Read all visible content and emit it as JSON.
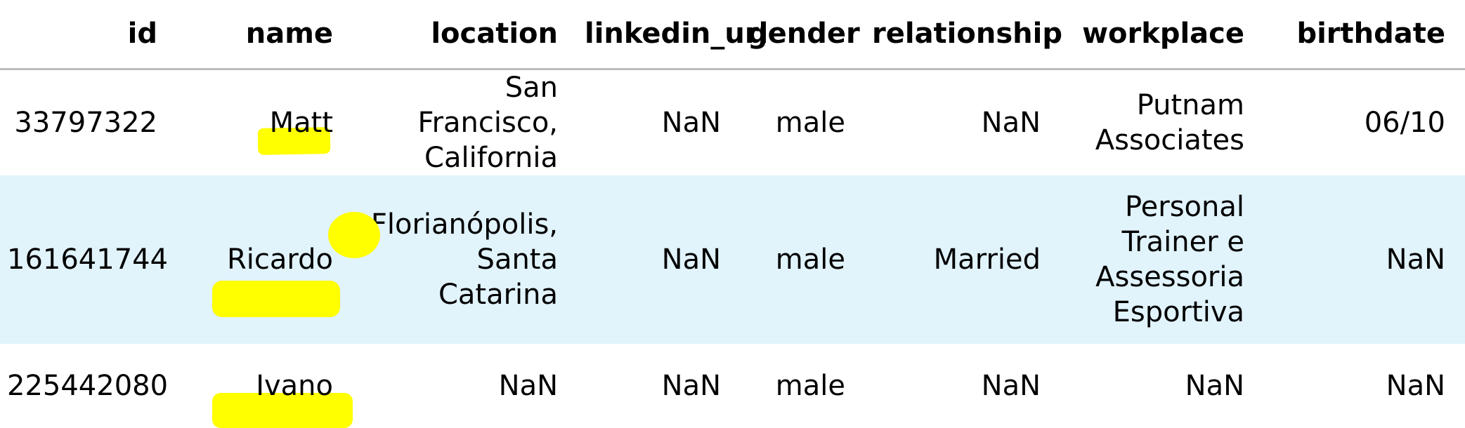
{
  "columns": [
    "id",
    "name",
    "location",
    "linkedin_url",
    "gender",
    "relationship",
    "workplace",
    "birthdate"
  ],
  "rows": [
    [
      "33797322",
      "Matt",
      "San Francisco, California",
      "NaN",
      "male",
      "NaN",
      "Putnam Associates",
      "06/10"
    ],
    [
      "161641744",
      "Ricardo",
      "Florianópolis, Santa Catarina",
      "NaN",
      "male",
      "Married",
      "Personal Trainer e Assessoria Esportiva",
      "NaN"
    ],
    [
      "225442080",
      "Ivano",
      "NaN",
      "NaN",
      "male",
      "NaN",
      "NaN",
      "NaN"
    ]
  ],
  "colors": {
    "highlight_row": "#e1f3fb",
    "redaction": "#ffff00",
    "header_rule": "#bdbdbd"
  }
}
